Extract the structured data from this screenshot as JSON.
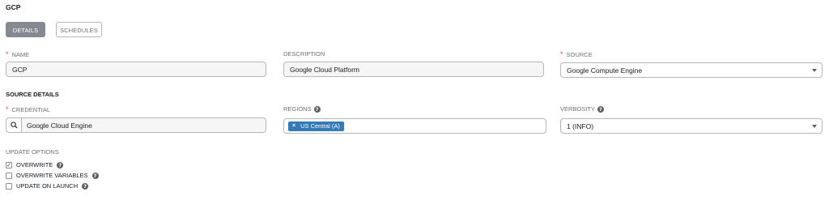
{
  "page": {
    "title": "GCP"
  },
  "tabs": [
    {
      "label": "DETAILS",
      "active": true
    },
    {
      "label": "SCHEDULES",
      "active": false
    }
  ],
  "fields": {
    "name": {
      "label": "NAME",
      "required": true,
      "value": "GCP"
    },
    "description": {
      "label": "DESCRIPTION",
      "required": false,
      "value": "Google Cloud Platform"
    },
    "source": {
      "label": "SOURCE",
      "required": true,
      "value": "Google Compute Engine"
    }
  },
  "source_details": {
    "heading": "SOURCE DETAILS",
    "credential": {
      "label": "CREDENTIAL",
      "required": true,
      "value": "Google Cloud Engine",
      "icon": "search-icon"
    },
    "regions": {
      "label": "REGIONS",
      "help_icon": "question-circle-icon",
      "tags": [
        "US Central (A)"
      ]
    },
    "verbosity": {
      "label": "VERBOSITY",
      "help_icon": "question-circle-icon",
      "value": "1 (INFO)"
    }
  },
  "update_options": {
    "heading": "UPDATE OPTIONS",
    "options": [
      {
        "label": "OVERWRITE",
        "checked": true
      },
      {
        "label": "OVERWRITE VARIABLES",
        "checked": false
      },
      {
        "label": "UPDATE ON LAUNCH",
        "checked": false
      }
    ]
  },
  "colors": {
    "accent": "#337ab7",
    "required": "#d9534f",
    "active_tab": "#848992"
  }
}
